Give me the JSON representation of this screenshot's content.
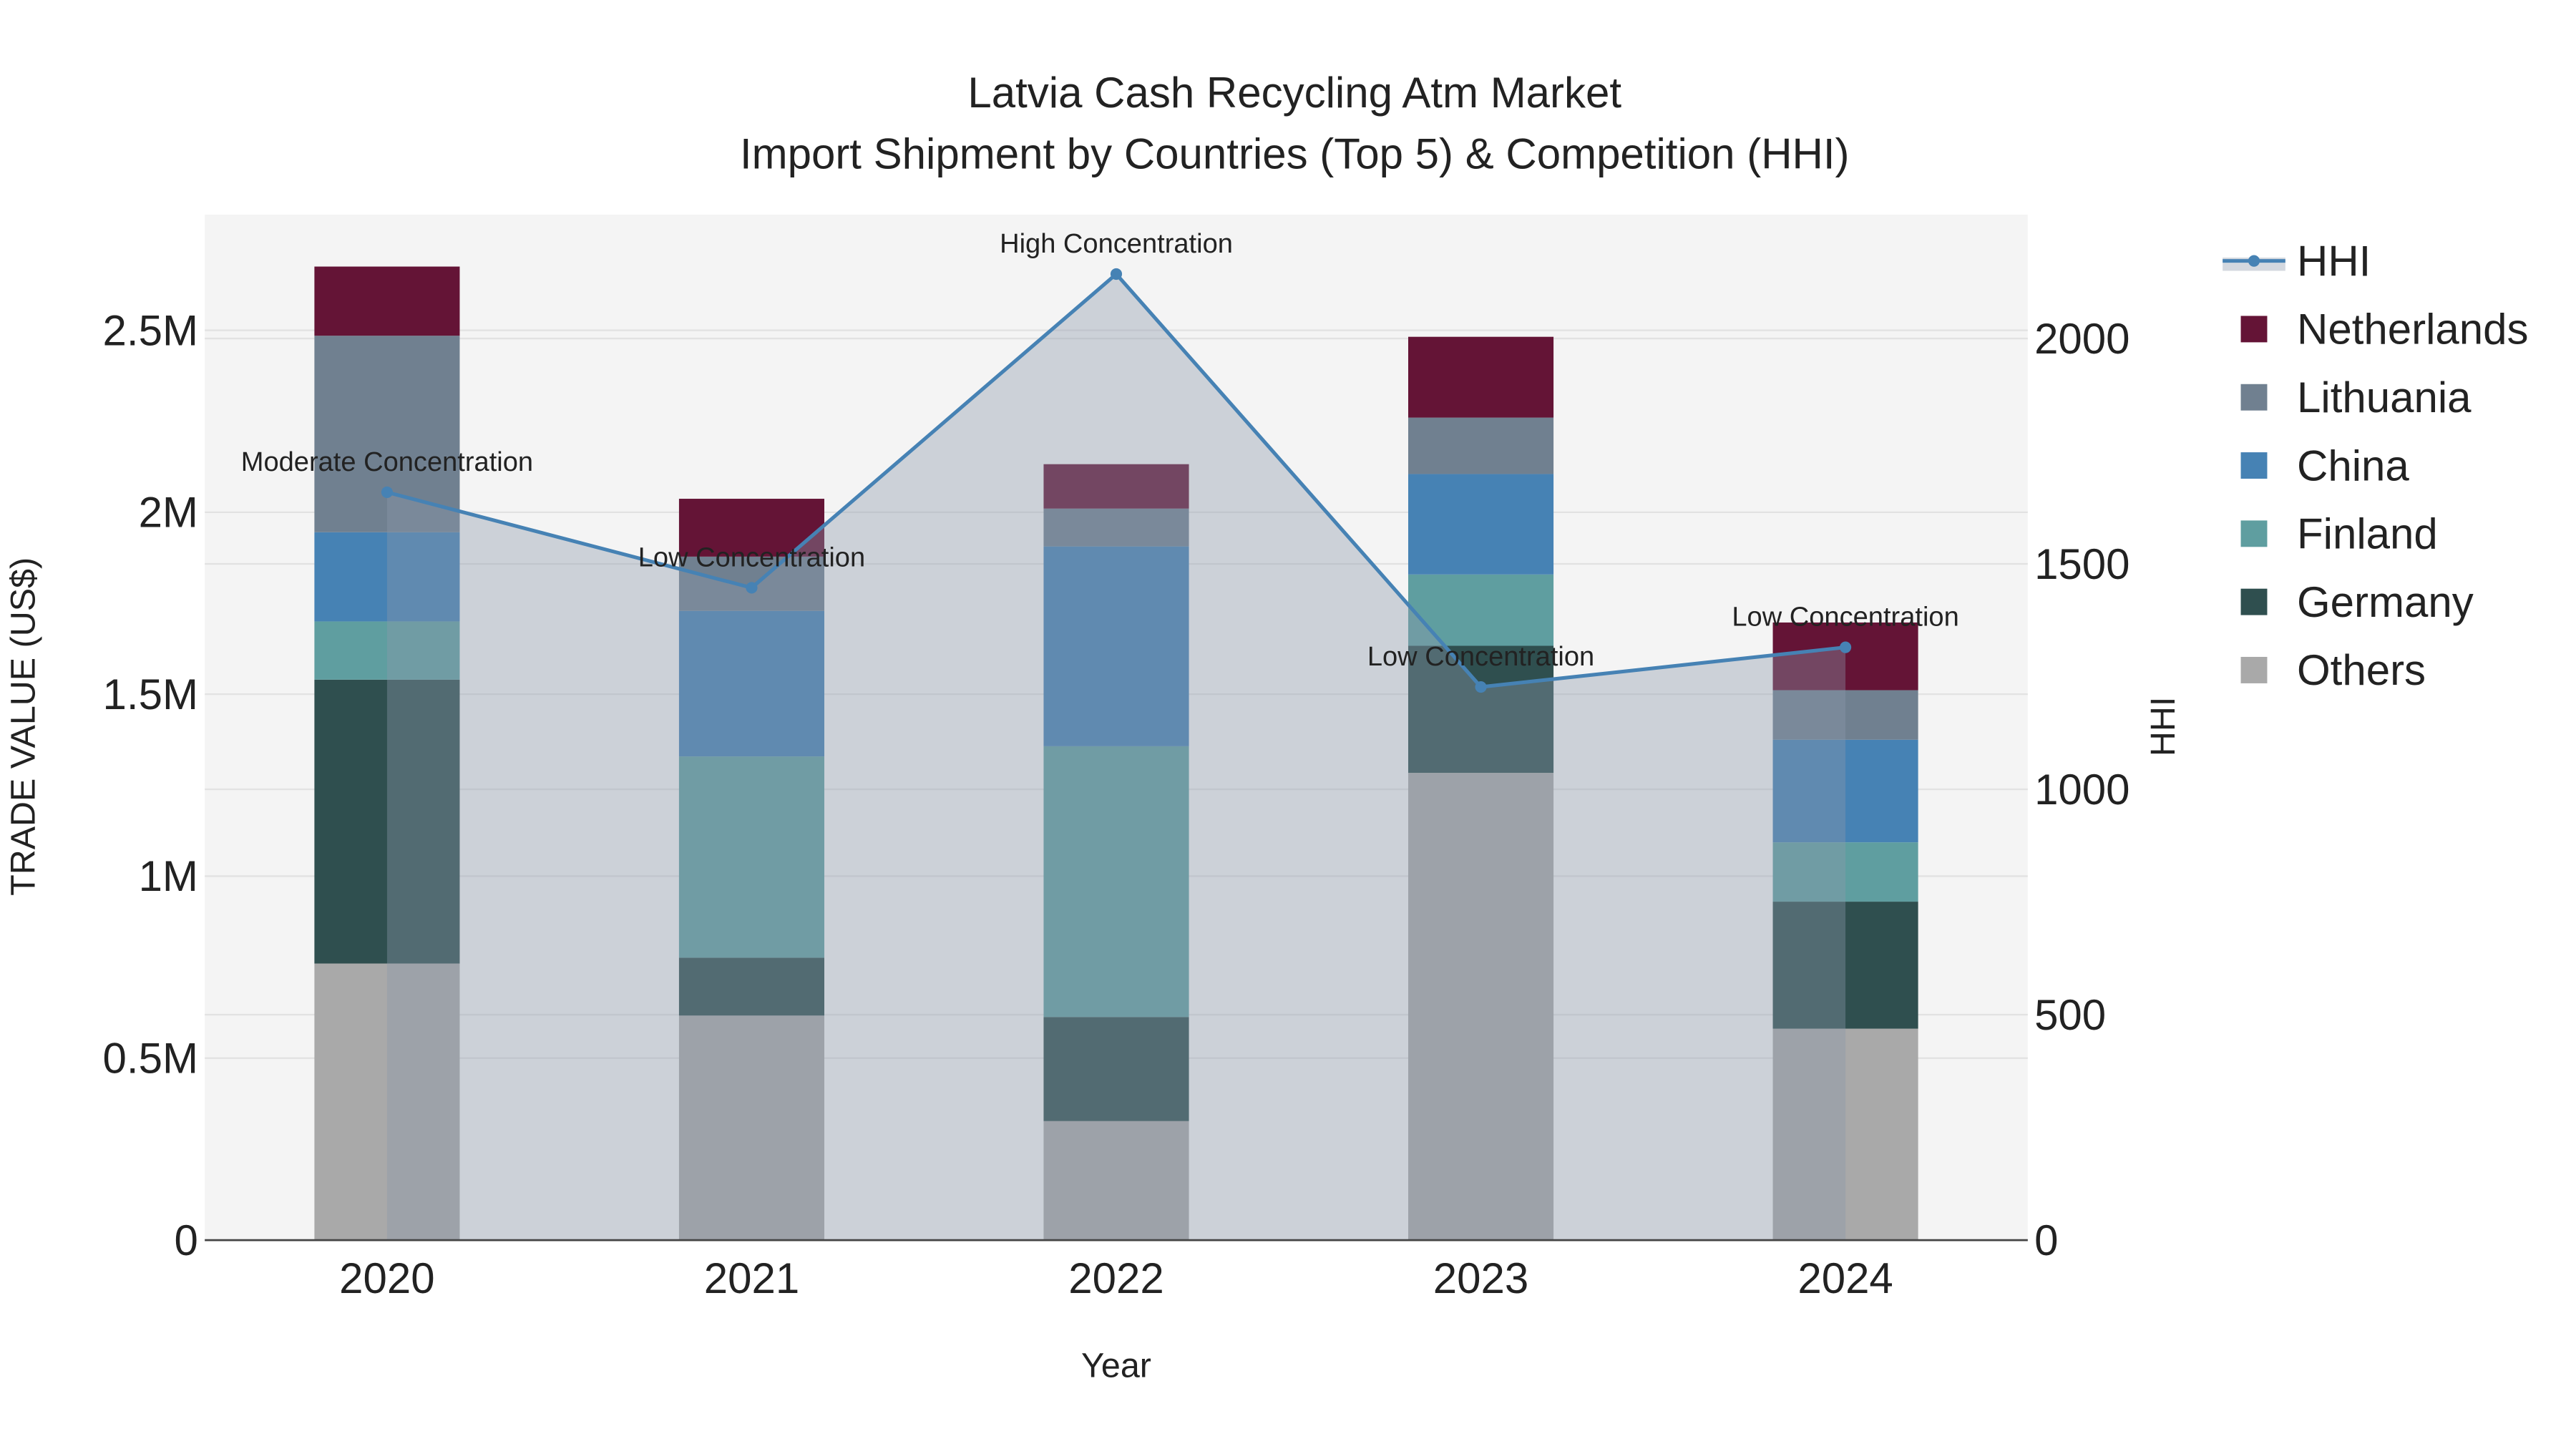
{
  "chart_data": {
    "type": "bar",
    "stacked": true,
    "title": "Latvia Cash Recycling Atm Market",
    "subtitle": "Import Shipment by Countries (Top 5) & Competition (HHI)",
    "xlabel": "Year",
    "ylabel": "TRADE VALUE (US$)",
    "y2label": "HHI",
    "categories": [
      "2020",
      "2021",
      "2022",
      "2023",
      "2024"
    ],
    "ylim": [
      0,
      2800000
    ],
    "y2lim": [
      0,
      2270
    ],
    "yticks": [
      {
        "v": 0,
        "label": "0"
      },
      {
        "v": 500000,
        "label": "0.5M"
      },
      {
        "v": 1000000,
        "label": "1M"
      },
      {
        "v": 1500000,
        "label": "1.5M"
      },
      {
        "v": 2000000,
        "label": "2M"
      },
      {
        "v": 2500000,
        "label": "2.5M"
      }
    ],
    "y2ticks": [
      {
        "v": 0,
        "label": "0"
      },
      {
        "v": 500,
        "label": "500"
      },
      {
        "v": 1000,
        "label": "1000"
      },
      {
        "v": 1500,
        "label": "1500"
      },
      {
        "v": 2000,
        "label": "2000"
      }
    ],
    "grid": true,
    "legend_position": "right",
    "series": [
      {
        "name": "Others",
        "color": "#a9a9a9",
        "values": [
          760000,
          617000,
          327000,
          1284000,
          581000
        ]
      },
      {
        "name": "Germany",
        "color": "#2f4f4f",
        "values": [
          780000,
          159000,
          286000,
          349000,
          349000
        ]
      },
      {
        "name": "Finland",
        "color": "#5f9ea0",
        "values": [
          160000,
          553000,
          744000,
          196000,
          163000
        ]
      },
      {
        "name": "China",
        "color": "#4682b4",
        "values": [
          245000,
          400000,
          549000,
          276000,
          282000
        ]
      },
      {
        "name": "Lithuania",
        "color": "#708090",
        "values": [
          540000,
          149000,
          104000,
          155000,
          136000
        ]
      },
      {
        "name": "Netherlands",
        "color": "#641436",
        "values": [
          190000,
          159000,
          122000,
          222000,
          186000
        ]
      }
    ],
    "hhi": {
      "name": "HHI",
      "color": "#4682b4",
      "values": [
        1659,
        1447,
        2143,
        1227,
        1315
      ],
      "annotations": [
        "Moderate Concentration",
        "Low Concentration",
        "High Concentration",
        "Low Concentration",
        "Low Concentration"
      ]
    },
    "legend": [
      "HHI",
      "Netherlands",
      "Lithuania",
      "China",
      "Finland",
      "Germany",
      "Others"
    ]
  }
}
